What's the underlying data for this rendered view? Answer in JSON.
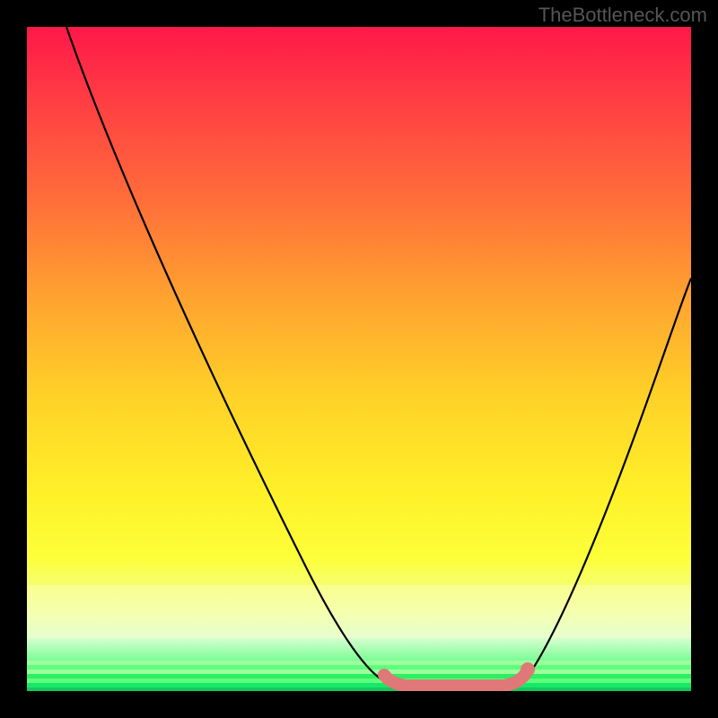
{
  "watermark": "TheBottleneck.com",
  "chart_data": {
    "type": "line",
    "title": "",
    "xlabel": "",
    "ylabel": "",
    "xlim": [
      0,
      100
    ],
    "ylim": [
      0,
      100
    ],
    "grid": false,
    "series": [
      {
        "name": "curve-left",
        "x": [
          6,
          10,
          15,
          20,
          25,
          30,
          35,
          40,
          45,
          50,
          54
        ],
        "values": [
          100,
          90,
          79,
          68,
          57,
          46,
          35,
          24,
          13,
          3,
          0
        ]
      },
      {
        "name": "curve-right",
        "x": [
          75,
          80,
          85,
          90,
          95,
          100
        ],
        "values": [
          0,
          9,
          20,
          33,
          47,
          62
        ]
      },
      {
        "name": "optimal-band",
        "x": [
          54,
          56,
          60,
          64,
          68,
          72,
          75
        ],
        "values": [
          2,
          0.5,
          0,
          0,
          0,
          0.5,
          2
        ]
      }
    ],
    "annotations": [
      {
        "type": "dot",
        "x": 75,
        "y": 2,
        "name": "end-marker"
      }
    ],
    "background": "rainbow-gradient-red-to-green"
  }
}
